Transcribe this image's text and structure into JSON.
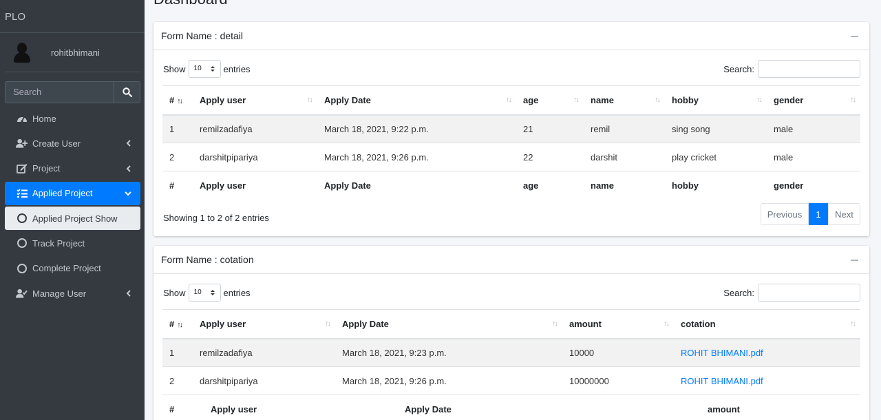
{
  "brand": "PLO",
  "user": {
    "name": "rohitbhimani"
  },
  "search": {
    "placeholder": "Search"
  },
  "nav": {
    "home": "Home",
    "create_user": "Create User",
    "project": "Project",
    "applied_project": "Applied Project",
    "applied_project_show": "Applied Project Show",
    "track_project": "Track Project",
    "complete_project": "Complete Project",
    "manage_user": "Manage User"
  },
  "page_title": "Dashboard",
  "table_labels": {
    "show": "Show",
    "entries": "entries",
    "search": "Search:",
    "length": "10"
  },
  "card1": {
    "title": "Form Name : detail",
    "headers": [
      "#",
      "Apply user",
      "Apply Date",
      "age",
      "name",
      "hobby",
      "gender"
    ],
    "rows": [
      [
        "1",
        "remilzadafiya",
        "March 18, 2021, 9:22 p.m.",
        "21",
        "remil",
        "sing song",
        "male"
      ],
      [
        "2",
        "darshitpipariya",
        "March 18, 2021, 9:26 p.m.",
        "22",
        "darshit",
        "play cricket",
        "male"
      ]
    ],
    "info": "Showing 1 to 2 of 2 entries",
    "pager": {
      "previous": "Previous",
      "page": "1",
      "next": "Next"
    }
  },
  "card2": {
    "title": "Form Name : cotation",
    "headers": [
      "#",
      "Apply user",
      "Apply Date",
      "amount",
      "cotation"
    ],
    "rows": [
      [
        "1",
        "remilzadafiya",
        "March 18, 2021, 9:23 p.m.",
        "10000",
        "ROHIT BHIMANI.pdf"
      ],
      [
        "2",
        "darshitpipariya",
        "March 18, 2021, 9:26 p.m.",
        "10000000",
        "ROHIT BHIMANI.pdf"
      ]
    ],
    "footer": [
      "#",
      "Apply user",
      "Apply Date",
      "amount"
    ]
  },
  "colors": {
    "accent": "#007bff",
    "sidebar": "#343a40",
    "link": "#007bff"
  }
}
